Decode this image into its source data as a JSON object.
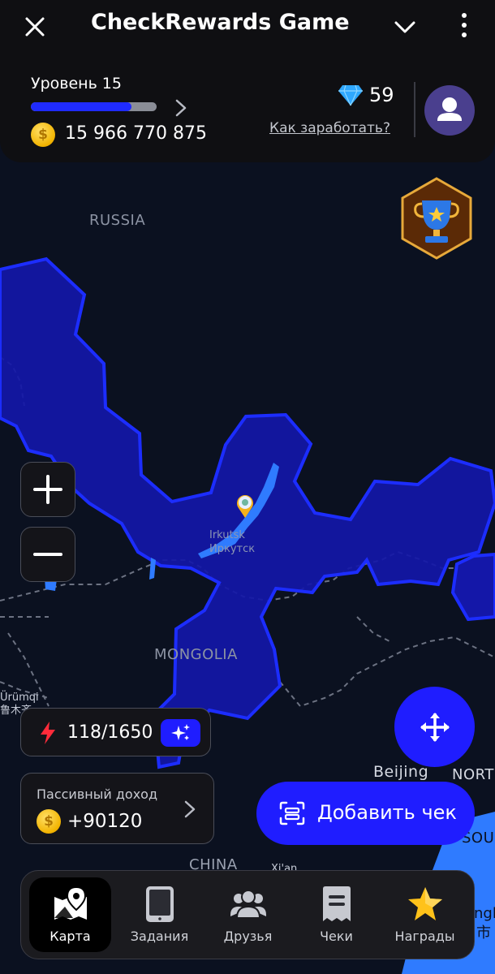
{
  "app_bar": {
    "title": "CheckRewards Game",
    "close_icon": "close-icon",
    "menu_icon": "chevron-down-icon",
    "more_icon": "more-vertical-icon"
  },
  "status": {
    "level_label": "Уровень 15",
    "level_progress": 0.8,
    "coin_balance": "15 966 770 875",
    "gems": "59",
    "earn_link": "Как заработать?"
  },
  "map": {
    "labels": {
      "russia": "RUSSIA",
      "mongolia": "MONGOLIA",
      "china": "CHINA",
      "beijing": "Beijing",
      "north": "NORT",
      "south": "SOU",
      "irkutsk_en": "Irkutsk",
      "irkutsk_ru": "Иркутск",
      "urumqi": "Ürümqi",
      "urumqi_cn": "鲁木齐",
      "xian": "Xi'an",
      "partial_right_1": "ngl",
      "partial_right_2": "市"
    },
    "colors": {
      "region_fill": "#1417a8",
      "region_border": "#1c2dff",
      "water": "#2f7bff",
      "land": "#0b1120"
    }
  },
  "controls": {
    "energy": "118/1650",
    "passive_label": "Пассивный доход",
    "passive_amount": "+90120",
    "add_receipt": "Добавить чек"
  },
  "nav": {
    "items": [
      {
        "label": "Карта",
        "icon": "map-pin-icon",
        "active": true
      },
      {
        "label": "Задания",
        "icon": "tablet-icon",
        "active": false
      },
      {
        "label": "Друзья",
        "icon": "friends-icon",
        "active": false
      },
      {
        "label": "Чеки",
        "icon": "receipt-icon",
        "active": false
      },
      {
        "label": "Награды",
        "icon": "star-icon",
        "active": false
      }
    ]
  },
  "accent_color": "#1f1dff"
}
